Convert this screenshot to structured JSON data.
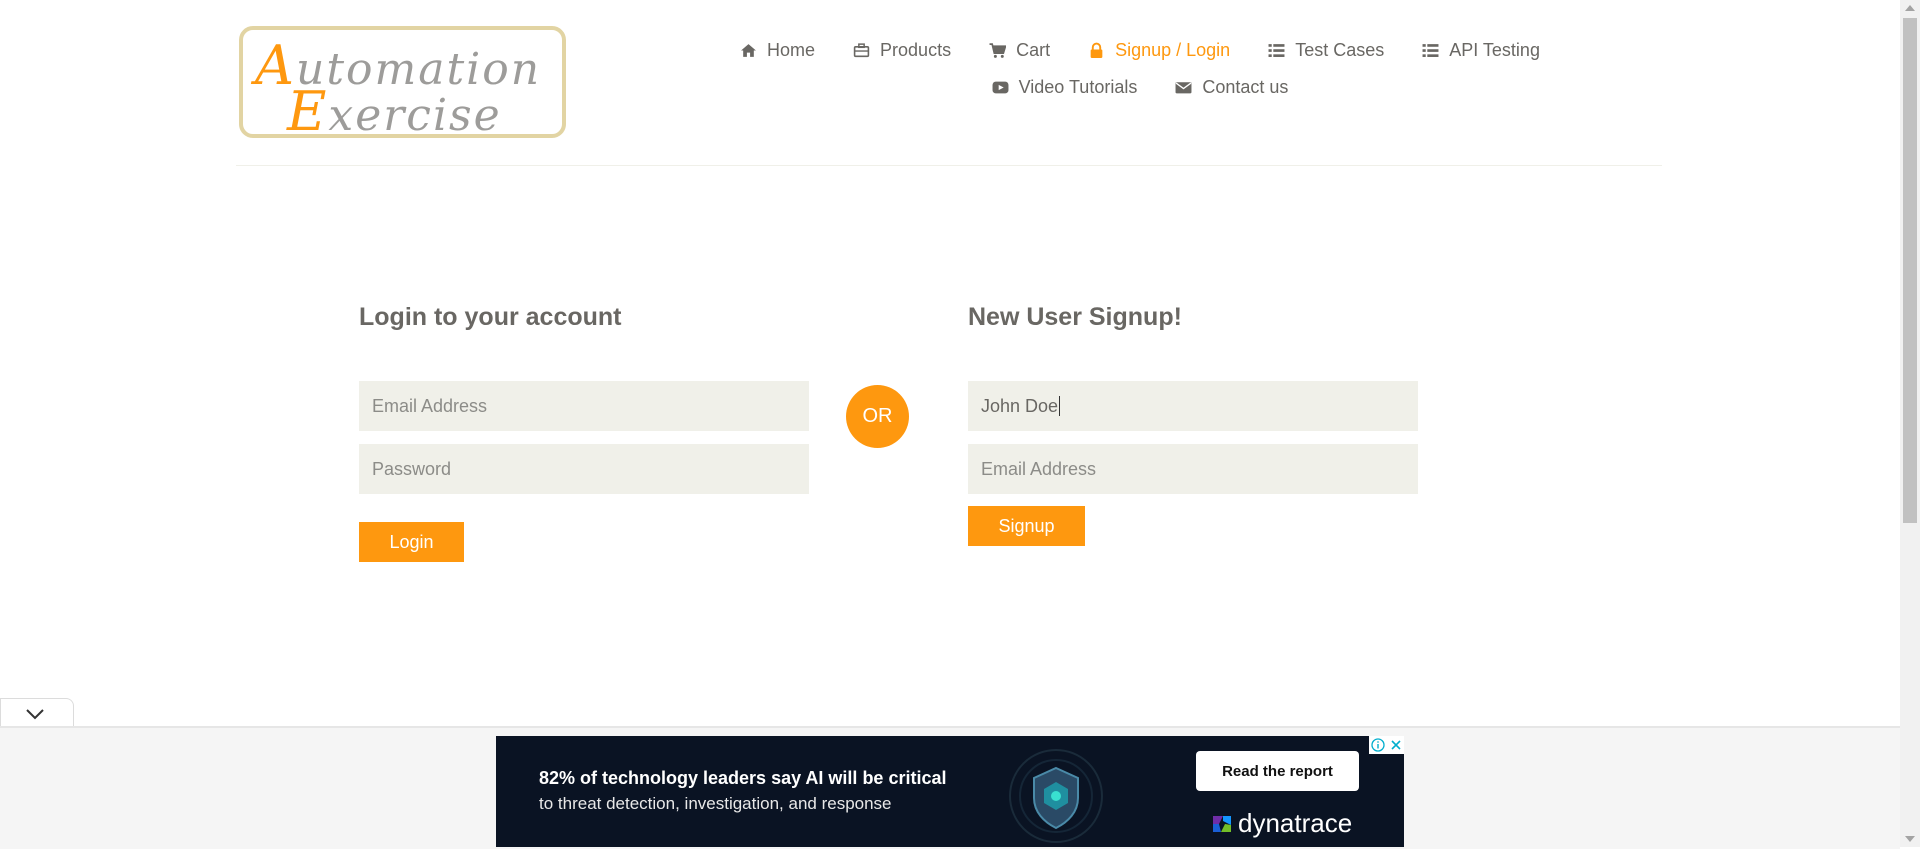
{
  "header": {
    "logo": {
      "line1_cap": "A",
      "line1_rest": "utomation",
      "line2_cap": "E",
      "line2_rest": "xercise"
    },
    "nav_row1": [
      {
        "label": "Home",
        "icon": "home-icon"
      },
      {
        "label": "Products",
        "icon": "briefcase-icon"
      },
      {
        "label": "Cart",
        "icon": "cart-icon"
      },
      {
        "label": "Signup / Login",
        "icon": "lock-icon",
        "active": true
      },
      {
        "label": "Test Cases",
        "icon": "list-icon"
      },
      {
        "label": "API Testing",
        "icon": "list-icon"
      }
    ],
    "nav_row2": [
      {
        "label": "Video Tutorials",
        "icon": "youtube-icon"
      },
      {
        "label": "Contact us",
        "icon": "envelope-icon"
      }
    ]
  },
  "login": {
    "title": "Login to your account",
    "email_placeholder": "Email Address",
    "password_placeholder": "Password",
    "button_label": "Login"
  },
  "divider": {
    "label": "OR"
  },
  "signup": {
    "title": "New User Signup!",
    "name_value": "John Doe",
    "email_placeholder": "Email Address",
    "button_label": "Signup"
  },
  "ad": {
    "headline": "82% of technology leaders say AI will be critical",
    "subline": "to threat detection, investigation, and response",
    "cta_label": "Read the report",
    "brand": "dynatrace"
  },
  "colors": {
    "accent": "#fe980f",
    "field_bg": "#f0f0e9",
    "text": "#696763",
    "ad_bg": "#0a1323"
  }
}
